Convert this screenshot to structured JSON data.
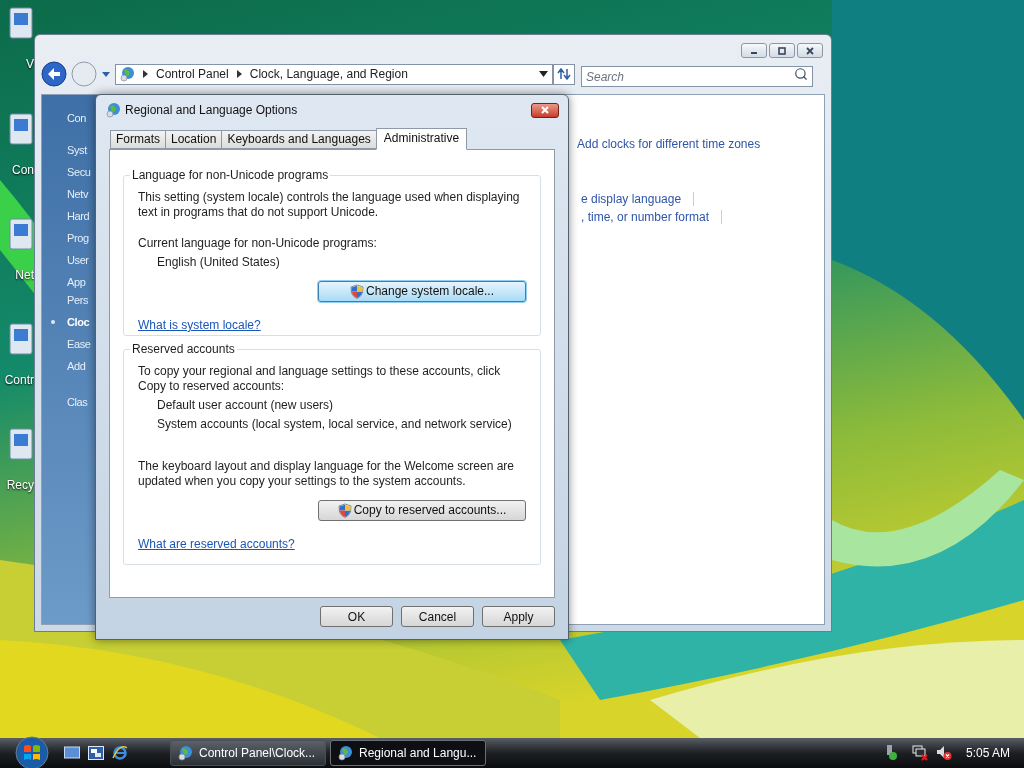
{
  "desktop": {
    "icons": [
      {
        "label": "V"
      },
      {
        "label": "Con"
      },
      {
        "label": "Net"
      },
      {
        "label": "Contr"
      },
      {
        "label": "Recy"
      }
    ]
  },
  "control_panel": {
    "address": [
      "Control Panel",
      "Clock, Language, and Region"
    ],
    "search": {
      "placeholder": "Search"
    },
    "sidebar": [
      {
        "label": "Con",
        "selected": false
      },
      {
        "label": "Syst",
        "selected": false
      },
      {
        "label": "Secu",
        "selected": false
      },
      {
        "label": "Netv",
        "selected": false
      },
      {
        "label": "Hard",
        "selected": false
      },
      {
        "label": "Prog",
        "selected": false
      },
      {
        "label": "User",
        "selected": false
      },
      {
        "label": "App",
        "selected": false
      },
      {
        "label": "Pers",
        "selected": false
      },
      {
        "label": "Cloc",
        "selected": true
      },
      {
        "label": "Ease",
        "selected": false
      },
      {
        "label": "Add",
        "selected": false
      },
      {
        "label": "Clas",
        "selected": false
      }
    ],
    "links": [
      "Add clocks for different time zones",
      "e display language",
      ", time, or number format"
    ]
  },
  "dialog": {
    "title": "Regional and Language Options",
    "tabs": [
      {
        "label": "Formats",
        "selected": false
      },
      {
        "label": "Location",
        "selected": false
      },
      {
        "label": "Keyboards and Languages",
        "selected": false
      },
      {
        "label": "Administrative",
        "selected": true
      }
    ],
    "sections": [
      {
        "title": "Language for non-Unicode programs",
        "description": "This setting (system locale) controls the language used when displaying text in programs that do not support Unicode.",
        "label": "Current language for non-Unicode programs:",
        "values": [
          "English (United States)"
        ],
        "button": {
          "label": "Change system locale...",
          "focused": true
        },
        "link": "What is system locale?"
      },
      {
        "title": "Reserved accounts",
        "description": "To copy your regional and language settings to these accounts, click Copy to reserved accounts:",
        "values": [
          "Default user account (new users)",
          "System accounts (local system, local service, and network service)"
        ],
        "note": "The keyboard layout and display language for the Welcome screen are updated when you copy your settings to the system accounts.",
        "button": {
          "label": "Copy to reserved accounts...",
          "focused": false
        },
        "link": "What are reserved accounts?"
      }
    ],
    "buttons": [
      "OK",
      "Cancel",
      "Apply"
    ]
  },
  "taskbar": {
    "tasks": [
      {
        "label": "Control Panel\\Clock...",
        "selected": false
      },
      {
        "label": "Regional and Langu...",
        "selected": true
      }
    ],
    "clock": "5:05 AM"
  }
}
